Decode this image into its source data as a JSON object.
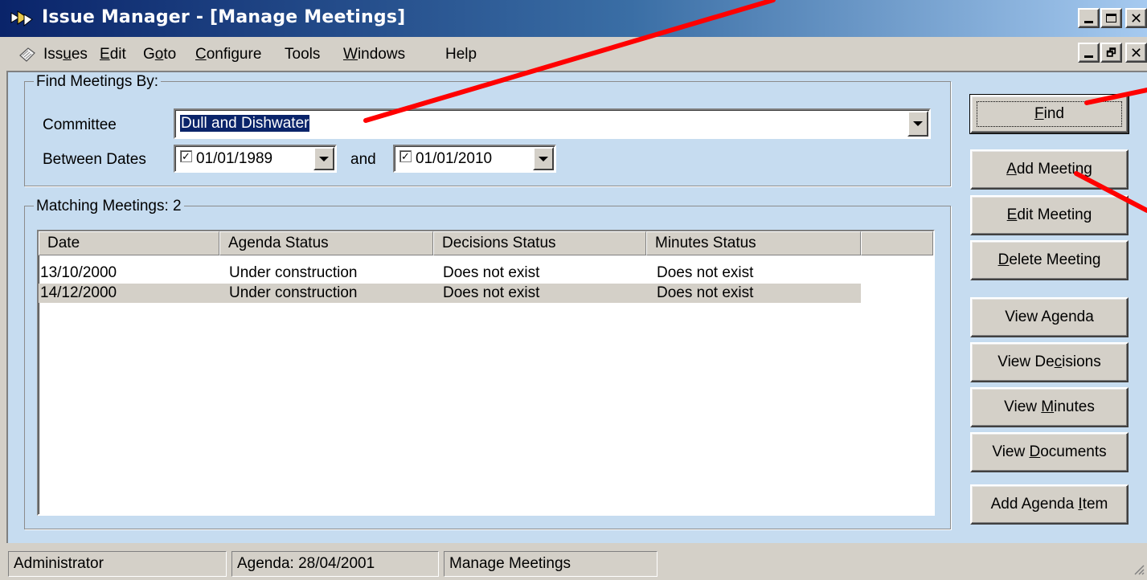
{
  "window": {
    "title": "Issue Manager - [Manage Meetings]",
    "icon": "app-icon",
    "controls": [
      "minimize-icon",
      "maximize-icon",
      "close-icon"
    ],
    "mdi_controls": [
      "minimize-icon",
      "restore-icon",
      "close-icon"
    ]
  },
  "menu": {
    "icon": "document-icon",
    "items": [
      {
        "label": "Issues",
        "accel_index": 3
      },
      {
        "label": "Edit",
        "accel_index": 0
      },
      {
        "label": "Goto",
        "accel_index": 1
      },
      {
        "label": "Configure",
        "accel_index": 0
      },
      {
        "label": "Tools",
        "accel_index": null
      },
      {
        "label": "Windows",
        "accel_index": 0
      },
      {
        "label": "Help",
        "accel_index": null
      }
    ]
  },
  "find_group": {
    "legend": "Find Meetings By:",
    "committee_label": "Committee",
    "committee_value": "Dull and Dishwater",
    "between_label": "Between Dates",
    "and_label": "and",
    "date_from": "01/01/1989",
    "date_from_checked": true,
    "date_to": "01/01/2010",
    "date_to_checked": true
  },
  "results_group": {
    "legend": "Matching Meetings: 2",
    "columns": [
      "Date",
      "Agenda Status",
      "Decisions Status",
      "Minutes Status"
    ],
    "rows": [
      {
        "date": "13/10/2000",
        "agenda": "Under construction",
        "decisions": "Does not exist",
        "minutes": "Does not exist",
        "selected": false
      },
      {
        "date": "14/12/2000",
        "agenda": "Under construction",
        "decisions": "Does not exist",
        "minutes": "Does not exist",
        "selected": true
      }
    ]
  },
  "buttons": {
    "find": {
      "pre": "",
      "key": "F",
      "post": "ind"
    },
    "add_meeting": {
      "pre": "",
      "key": "A",
      "post": "dd Meeting"
    },
    "edit_meeting": {
      "pre": "",
      "key": "E",
      "post": "dit Meeting"
    },
    "delete_meeting": {
      "pre": "",
      "key": "D",
      "post": "elete Meeting"
    },
    "view_agenda": {
      "pre": "View Agenda",
      "key": "",
      "post": ""
    },
    "view_decisions": {
      "pre": "View De",
      "key": "c",
      "post": "isions"
    },
    "view_minutes": {
      "pre": "View ",
      "key": "M",
      "post": "inutes"
    },
    "view_documents": {
      "pre": "View ",
      "key": "D",
      "post": "ocuments"
    },
    "add_agenda_item": {
      "pre": "Add Agenda ",
      "key": "I",
      "post": "tem"
    }
  },
  "status": {
    "user": "Administrator",
    "agenda": "Agenda: 28/04/2001",
    "screen": "Manage Meetings"
  },
  "colors": {
    "titlebar_start": "#0a246a",
    "titlebar_end": "#a6caf0",
    "client_background": "#c6dcf0",
    "selection": "#0a246a",
    "annotation_arrow": "#ff0000"
  }
}
